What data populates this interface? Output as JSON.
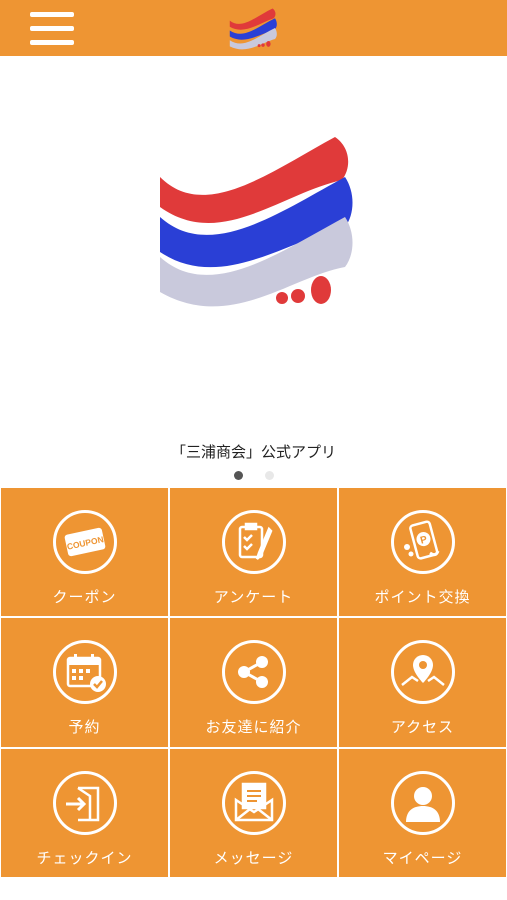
{
  "header": {
    "menu_icon": "hamburger-icon",
    "logo": "miura-shokai-logo"
  },
  "hero": {
    "caption": "「三浦商会」公式アプリ",
    "carousel": {
      "current": 1,
      "total": 2
    }
  },
  "colors": {
    "brand_orange": "#ee9533",
    "logo_red": "#e03a3a",
    "logo_blue": "#2a3fd6",
    "logo_gray": "#c9c9dc"
  },
  "menu": [
    {
      "label": "クーポン",
      "icon": "coupon-icon"
    },
    {
      "label": "アンケート",
      "icon": "survey-clipboard-icon"
    },
    {
      "label": "ポイント交換",
      "icon": "point-exchange-phone-icon"
    },
    {
      "label": "予約",
      "icon": "calendar-check-icon"
    },
    {
      "label": "お友達に紹介",
      "icon": "share-icon"
    },
    {
      "label": "アクセス",
      "icon": "map-pin-icon"
    },
    {
      "label": "チェックイン",
      "icon": "checkin-door-icon"
    },
    {
      "label": "メッセージ",
      "icon": "message-envelope-icon"
    },
    {
      "label": "マイページ",
      "icon": "user-profile-icon"
    }
  ]
}
